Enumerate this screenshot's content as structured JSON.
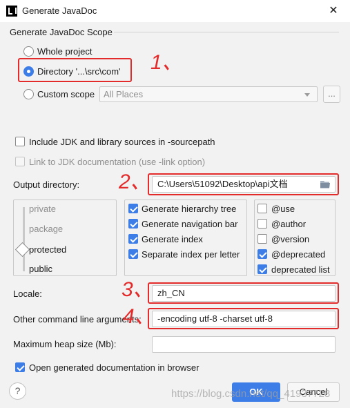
{
  "window": {
    "title": "Generate JavaDoc",
    "close_label": "✕"
  },
  "scope": {
    "group_title": "Generate JavaDoc Scope",
    "whole_project": "Whole project",
    "directory": "Directory '...\\src\\com'",
    "custom_scope": "Custom scope",
    "custom_scope_value": "All Places",
    "ellipsis": "..."
  },
  "options": {
    "include_jdk": "Include JDK and library sources in -sourcepath",
    "link_jdk": "Link to JDK documentation (use -link option)"
  },
  "output": {
    "label": "Output directory:",
    "value": "C:\\Users\\51092\\Desktop\\api文档"
  },
  "visibility": {
    "levels": [
      "private",
      "package",
      "protected",
      "public"
    ],
    "selected": "protected"
  },
  "generate": {
    "hierarchy_tree": "Generate hierarchy tree",
    "navigation_bar": "Generate navigation bar",
    "index": "Generate index",
    "separate_index": "Separate index per letter"
  },
  "tags": {
    "use": "@use",
    "author": "@author",
    "version": "@version",
    "deprecated": "@deprecated",
    "deprecated_list": "deprecated list"
  },
  "locale": {
    "label": "Locale:",
    "value": "zh_CN"
  },
  "args": {
    "label": "Other command line arguments:",
    "value": "-encoding utf-8 -charset utf-8"
  },
  "heap": {
    "label": "Maximum heap size (Mb):",
    "value": ""
  },
  "open_browser": "Open generated documentation in browser",
  "buttons": {
    "ok": "OK",
    "cancel": "Cancel",
    "help": "?"
  },
  "annotations": {
    "n1": "1、",
    "n2": "2、",
    "n3": "3、",
    "n4": "4、"
  },
  "watermark": "https://blog.csdn.net/qq_41937728",
  "colors": {
    "accent": "#3c7de8",
    "annotation_red": "#e32b2b"
  }
}
